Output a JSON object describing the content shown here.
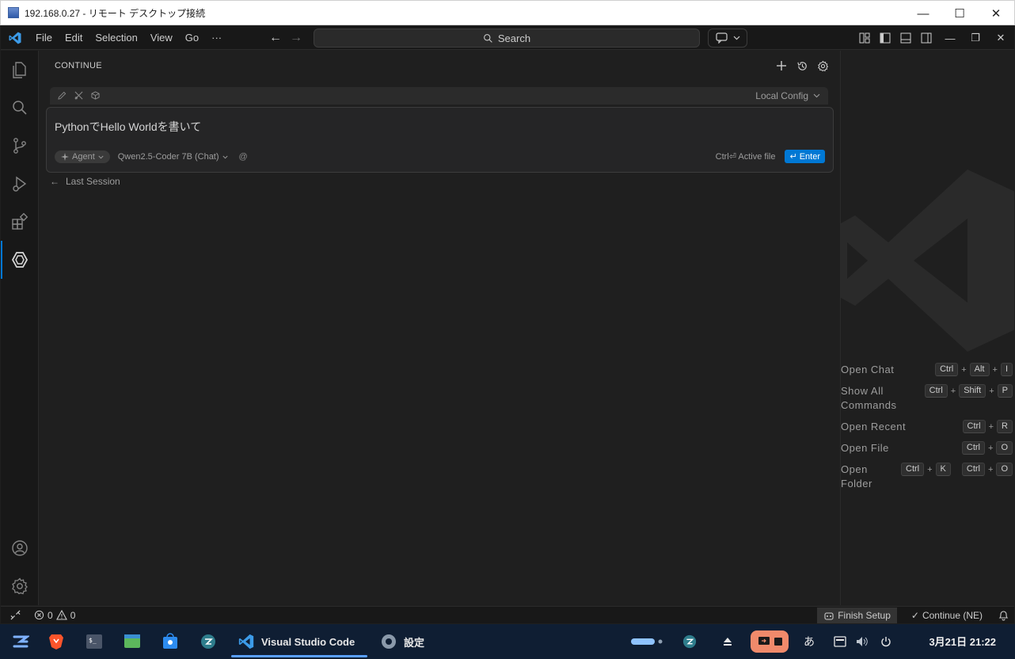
{
  "window": {
    "title": "192.168.0.27 - リモート デスクトップ接続"
  },
  "menu": {
    "file": "File",
    "edit": "Edit",
    "selection": "Selection",
    "view": "View",
    "go": "Go",
    "more": "···"
  },
  "search": {
    "label": "Search"
  },
  "panel": {
    "title": "CONTINUE",
    "config_label": "Local Config",
    "prompt_text": "PythonでHello Worldを書いて",
    "agent_label": "Agent",
    "model_label": "Qwen2.5-Coder 7B (Chat)",
    "active_file_hint": "Ctrl⏎ Active file",
    "enter_label": "Enter",
    "last_session": "Last Session"
  },
  "shortcuts": [
    {
      "label": "Open Chat",
      "keys": [
        "Ctrl",
        "Alt",
        "I"
      ]
    },
    {
      "label": "Show All Commands",
      "keys": [
        "Ctrl",
        "Shift",
        "P"
      ]
    },
    {
      "label": "Open Recent",
      "keys": [
        "Ctrl",
        "R"
      ]
    },
    {
      "label": "Open File",
      "keys": [
        "Ctrl",
        "O"
      ]
    },
    {
      "label": "Open Folder",
      "keys": [
        "Ctrl",
        "K",
        "Ctrl",
        "O"
      ]
    }
  ],
  "status": {
    "errors": "0",
    "warnings": "0",
    "finish_setup": "Finish Setup",
    "continue": "Continue (NE)"
  },
  "taskbar": {
    "vscode_label": "Visual Studio Code",
    "settings_label": "設定",
    "ime": "あ",
    "clock": "3月21日  21:22"
  },
  "colors": {
    "accent": "#0078d4",
    "editor_bg": "#1f1f1f",
    "chrome_bg": "#181818",
    "taskbar_bg": "#0f1e33"
  }
}
